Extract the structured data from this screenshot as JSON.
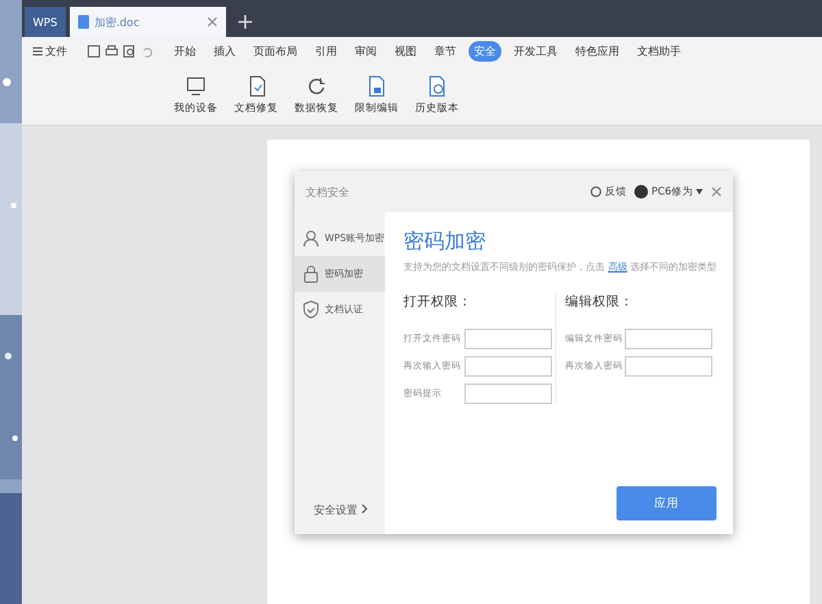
{
  "tabs": [
    {
      "label": "WPS",
      "kind": "home",
      "selected": false
    },
    {
      "label": "加密.doc",
      "kind": "document",
      "selected": true
    }
  ],
  "menu": [
    {
      "label": "文件",
      "kind": "file",
      "selected": false
    },
    {
      "label": "开始",
      "kind": "tab",
      "selected": false
    },
    {
      "label": "插入",
      "kind": "tab",
      "selected": false
    },
    {
      "label": "页面布局",
      "kind": "tab",
      "selected": false
    },
    {
      "label": "引用",
      "kind": "tab",
      "selected": false
    },
    {
      "label": "审阅",
      "kind": "tab",
      "selected": false
    },
    {
      "label": "视图",
      "kind": "tab",
      "selected": false
    },
    {
      "label": "章节",
      "kind": "tab",
      "selected": false
    },
    {
      "label": "安全",
      "kind": "tab",
      "selected": true
    },
    {
      "label": "开发工具",
      "kind": "tab",
      "selected": false
    },
    {
      "label": "特色应用",
      "kind": "tab",
      "selected": false
    },
    {
      "label": "文档助手",
      "kind": "tab",
      "selected": false
    }
  ],
  "ribbon": [
    {
      "label": "我的设备",
      "kind": "device"
    },
    {
      "label": "文档修复",
      "kind": "repair"
    },
    {
      "label": "数据恢复",
      "kind": "restore"
    },
    {
      "label": "限制编辑",
      "kind": "lock"
    },
    {
      "label": "历史版本",
      "kind": "history"
    }
  ],
  "dialog": {
    "title": "文档安全",
    "feedback": "反馈",
    "user": "PC6修为",
    "sidebar": [
      {
        "label": "WPS账号加密",
        "kind": "account",
        "selected": false
      },
      {
        "label": "密码加密",
        "kind": "lock",
        "selected": true
      },
      {
        "label": "文档认证",
        "kind": "shield",
        "selected": false
      }
    ],
    "settings_link": "安全设置",
    "heading": "密码加密",
    "description": {
      "before": "支持为您的文档设置不同级别的密码保护，点击",
      "link": "高级",
      "after": "选择不同的加密类型"
    },
    "sections": [
      {
        "title": "打开权限：",
        "fields": [
          {
            "label": "打开文件密码"
          },
          {
            "label": "再次输入密码"
          },
          {
            "label": "密码提示"
          }
        ]
      },
      {
        "title": "编辑权限：",
        "fields": [
          {
            "label": "编辑文件密码"
          },
          {
            "label": "再次输入密码"
          }
        ]
      }
    ],
    "apply_button": "应用"
  }
}
